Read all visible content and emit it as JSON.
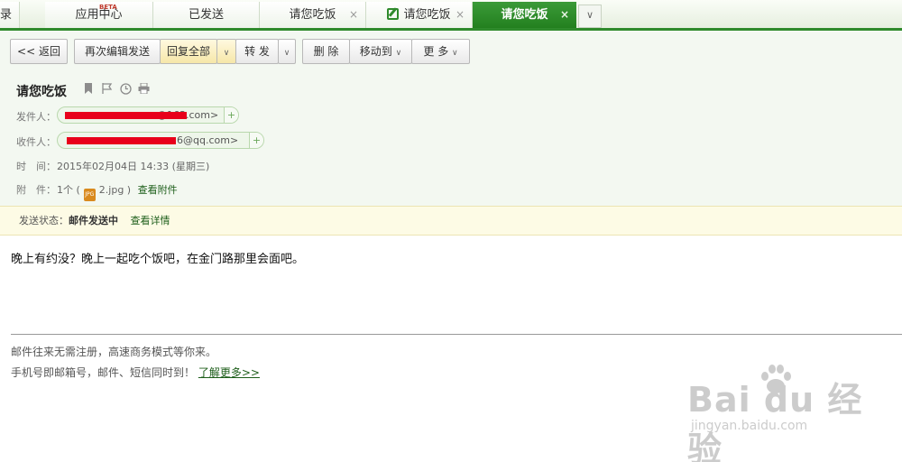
{
  "tabs": [
    {
      "label": "录",
      "closable": false
    },
    {
      "label": "应用中心",
      "badge": "BETA",
      "closable": false
    },
    {
      "label": "已发送",
      "closable": false
    },
    {
      "label": "请您吃饭",
      "closable": true
    },
    {
      "label": "请您吃饭",
      "closable": true,
      "icon": "edit-icon"
    },
    {
      "label": "请您吃饭",
      "closable": true,
      "active": true
    }
  ],
  "tab_close_glyph": "×",
  "tab_more_glyph": "∨",
  "toolbar": {
    "back": "<< 返回",
    "reedit": "再次编辑发送",
    "reply_all": "回复全部",
    "forward": "转 发",
    "delete": "删 除",
    "move_to": "移动到",
    "more": "更 多",
    "dropdown_glyph": "∨"
  },
  "mail": {
    "subject": "请您吃饭",
    "from_label": "发件人：",
    "from_visible": "@163.com>",
    "to_label": "收件人：",
    "to_visible": "6@qq.com>",
    "time_label": "时　间：",
    "time_value": "2015年02月04日 14:33 (星期三)",
    "attach_label": "附　件：",
    "attach_count": "1个 (",
    "attach_icon_text": "JPG",
    "attach_name": "2.jpg )",
    "attach_view": "查看附件",
    "plus": "+"
  },
  "status": {
    "label": "发送状态：",
    "value": "邮件发送中",
    "detail": "查看详情"
  },
  "body": {
    "text": "晚上有约没？晚上一起吃个饭吧，在金门路那里会面吧。"
  },
  "footer": {
    "line1": "邮件往来无需注册，高速商务模式等你来。",
    "line2": "手机号即邮箱号，邮件、短信同时到！",
    "link": "了解更多>>"
  },
  "watermark": {
    "brand": "Bai  du 经验",
    "url": "jingyan.baidu.com"
  },
  "colors": {
    "accent": "#2f8a2c",
    "redaction": "#e8001a",
    "status_bg": "#fdfbe5"
  }
}
